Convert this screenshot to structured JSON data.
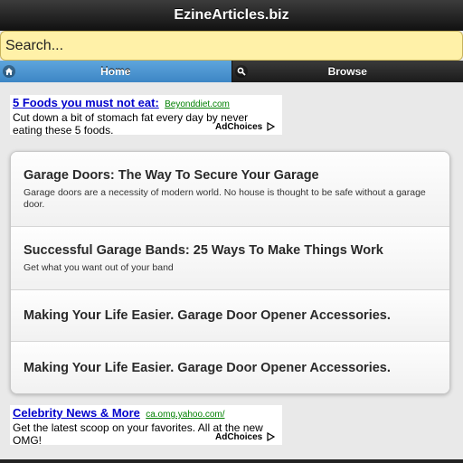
{
  "header": {
    "title": "EzineArticles.biz"
  },
  "search": {
    "placeholder": "Search..."
  },
  "nav": {
    "home_label": "Home",
    "browse_label": "Browse"
  },
  "ads": {
    "top": {
      "title": "5 Foods you must not eat:",
      "url": "Beyonddiet.com",
      "body": "Cut down a bit of stomach fat every day by never eating these 5 foods.",
      "adchoices": "AdChoices"
    },
    "bottom": {
      "title": "Celebrity News & More",
      "url": "ca.omg.yahoo.com/",
      "body": "Get the latest scoop on your favorites. All at the new OMG!",
      "adchoices": "AdChoices"
    }
  },
  "articles": [
    {
      "title": "Garage Doors: The Way To Secure Your Garage",
      "desc": "Garage doors are a necessity of modern world. No house is thought to be safe without a garage door."
    },
    {
      "title": "Successful Garage Bands: 25 Ways To Make Things Work",
      "desc": "Get what you want out of your band"
    },
    {
      "title": "Making Your Life Easier. Garage Door Opener Accessories."
    },
    {
      "title": "Making Your Life Easier. Garage Door Opener Accessories."
    }
  ]
}
